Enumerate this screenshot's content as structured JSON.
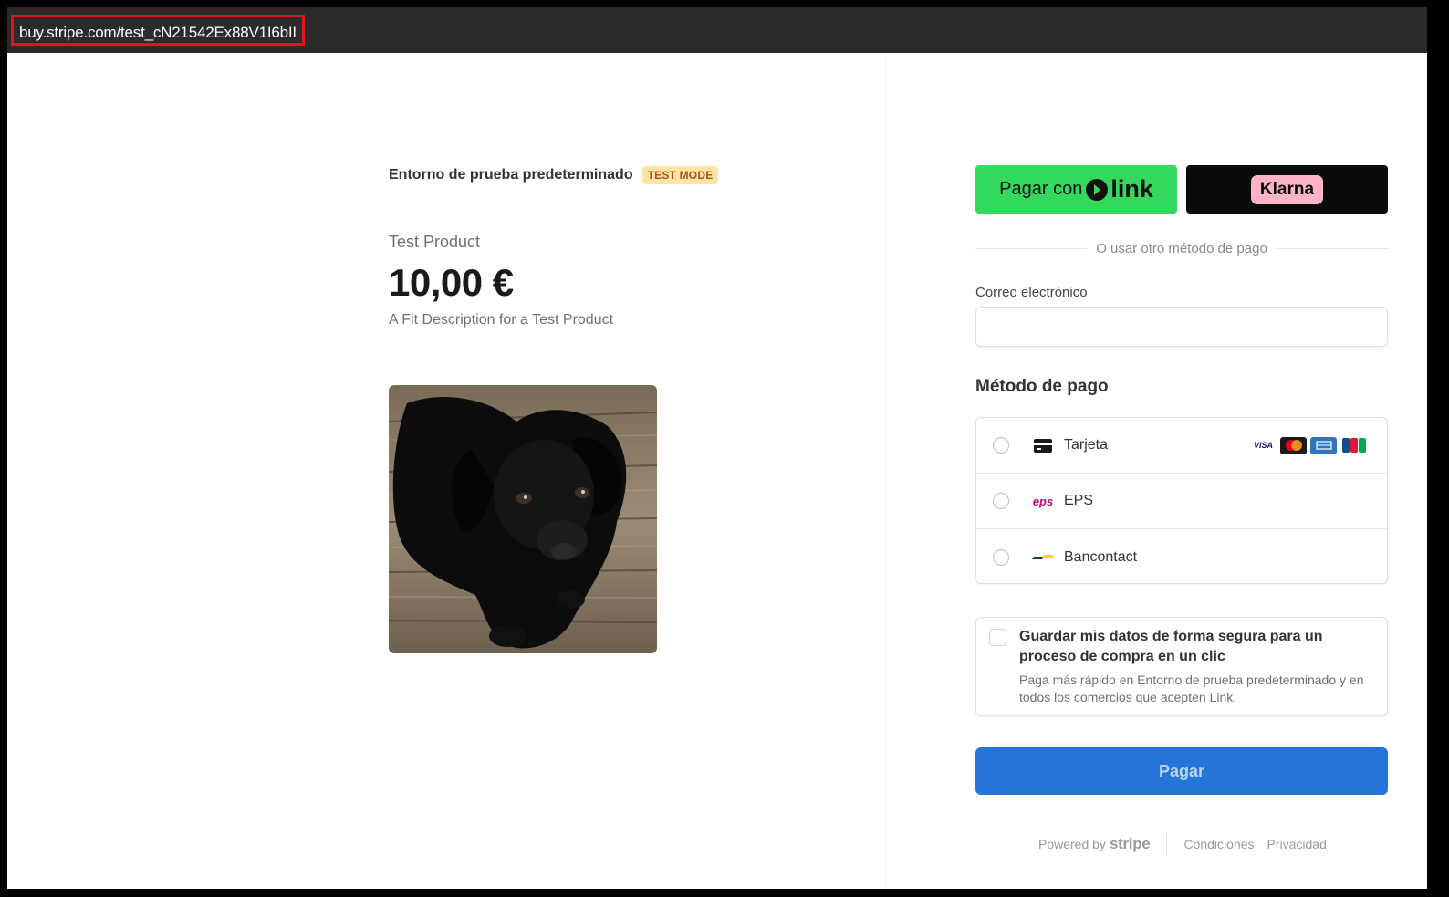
{
  "browser": {
    "url": "buy.stripe.com/test_cN21542Ex88V1I6bII"
  },
  "product": {
    "merchant": "Entorno de prueba predeterminado",
    "badge": "TEST MODE",
    "name": "Test Product",
    "price": "10,00 €",
    "description": "A Fit Description for a Test Product",
    "image_alt": "black puppy on wooden floor"
  },
  "checkout": {
    "link_button_prefix": "Pagar con",
    "link_logo": "link",
    "klarna_label": "Klarna",
    "divider_text": "O usar otro método de pago",
    "email_label": "Correo electrónico",
    "email_value": "",
    "payment_method_title": "Método de pago",
    "methods": [
      {
        "label": "Tarjeta",
        "icon": "card-icon"
      },
      {
        "label": "EPS",
        "icon": "eps-icon",
        "logo_text": "eps"
      },
      {
        "label": "Bancontact",
        "icon": "bancontact-icon"
      }
    ],
    "card_brands": [
      "VISA",
      "Mastercard",
      "Amex",
      "JCB"
    ],
    "save_title": "Guardar mis datos de forma segura para un proceso de compra en un clic",
    "save_desc": "Paga más rápido en Entorno de prueba predeterminado y en todos los comercios que acepten Link.",
    "pay_button": "Pagar"
  },
  "footer": {
    "powered_by": "Powered by",
    "stripe": "stripe",
    "terms": "Condiciones",
    "privacy": "Privacidad"
  },
  "colors": {
    "link_green": "#33d95c",
    "klarna_pink": "#ffb3c7",
    "pay_blue": "#2574d8",
    "url_highlight": "#e0141e",
    "badge_bg": "#ffe3a3"
  }
}
